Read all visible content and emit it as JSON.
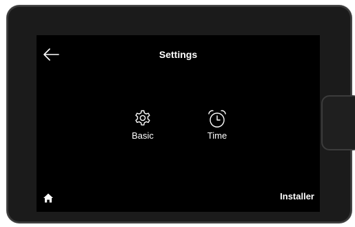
{
  "header": {
    "title": "Settings",
    "back_icon": "arrow-left-icon"
  },
  "tiles": [
    {
      "label": "Basic",
      "icon": "gear-icon"
    },
    {
      "label": "Time",
      "icon": "alarm-clock-icon"
    }
  ],
  "footer": {
    "home_icon": "home-icon",
    "installer_label": "Installer"
  },
  "colors": {
    "screen_bg": "#000000",
    "text": "#ffffff",
    "bezel": "#1b1b1b"
  }
}
